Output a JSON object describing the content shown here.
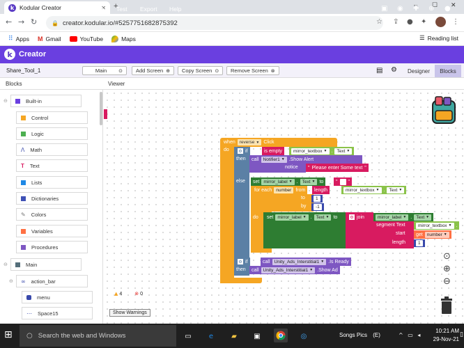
{
  "browser": {
    "tab_title": "Kodular Creator",
    "new_tab": "+",
    "url": "creator.kodular.io/#5257751682875392",
    "bookmarks": [
      "Apps",
      "Gmail",
      "YouTube",
      "Maps"
    ],
    "reading_list": "Reading list",
    "window_controls": [
      "–",
      "☐",
      "✕"
    ]
  },
  "app": {
    "brand": "Creator",
    "menu": [
      "Project",
      "Test",
      "Export",
      "Help"
    ],
    "project_name": "Share_Tool_1",
    "screen_select": "Main",
    "add_screen": "Add Screen",
    "copy_screen": "Copy Screen",
    "remove_screen": "Remove Screen",
    "designer": "Designer",
    "blocks": "Blocks",
    "blocks_label": "Blocks",
    "viewer_label": "Viewer"
  },
  "sidebar": {
    "builtin": "Built-in",
    "builtin_items": [
      "Control",
      "Logic",
      "Math",
      "Text",
      "Lists",
      "Dictionaries",
      "Colors",
      "Variables",
      "Procedures"
    ],
    "main": "Main",
    "action_bar": "action_bar",
    "children": [
      "menu",
      "Space15"
    ]
  },
  "blocks": {
    "when": "when",
    "reverse": "reverse",
    "click": "Click",
    "do": "do",
    "if": "if",
    "is_empty": "is empty",
    "mirror_textbox": "mirror_textbox",
    "text": "Text",
    "then": "then",
    "call": "call",
    "notifier": "Notifier1",
    "show_alert": ".Show Alert",
    "notice": "notice",
    "alert_text": "Please enter Some text",
    "else": "else",
    "set": "set",
    "mirror_label": "mirror_label",
    "to": "to",
    "for_each": "for each",
    "number": "number",
    "from": "from",
    "length": "length",
    "one": "1",
    "by": "by",
    "neg_one": "-1",
    "join": "join",
    "segment": "segment",
    "start": "start",
    "get": "get",
    "unity": "Unity_Ads_Interstitial1",
    "is_ready": ".Is Ready",
    "show_ad": ".Show Ad",
    "warn_count": "4",
    "err_count": "0",
    "show_warnings": "Show Warnings"
  },
  "taskbar": {
    "search": "Type here to search",
    "search_placeholder": "Search the web and Windows",
    "songs": "Songs Pics",
    "lang": "(E)",
    "time": "10:21 AM",
    "date": "29-Nov-21"
  },
  "colors": {
    "accent": "#6a3fe0",
    "event": "#f5a623",
    "logic": "#5b80a5",
    "text": "#d81b60",
    "component": "#7e57c2",
    "set": "#2e7d32",
    "math": "#3949ab",
    "textbox": "#8bc34a"
  }
}
